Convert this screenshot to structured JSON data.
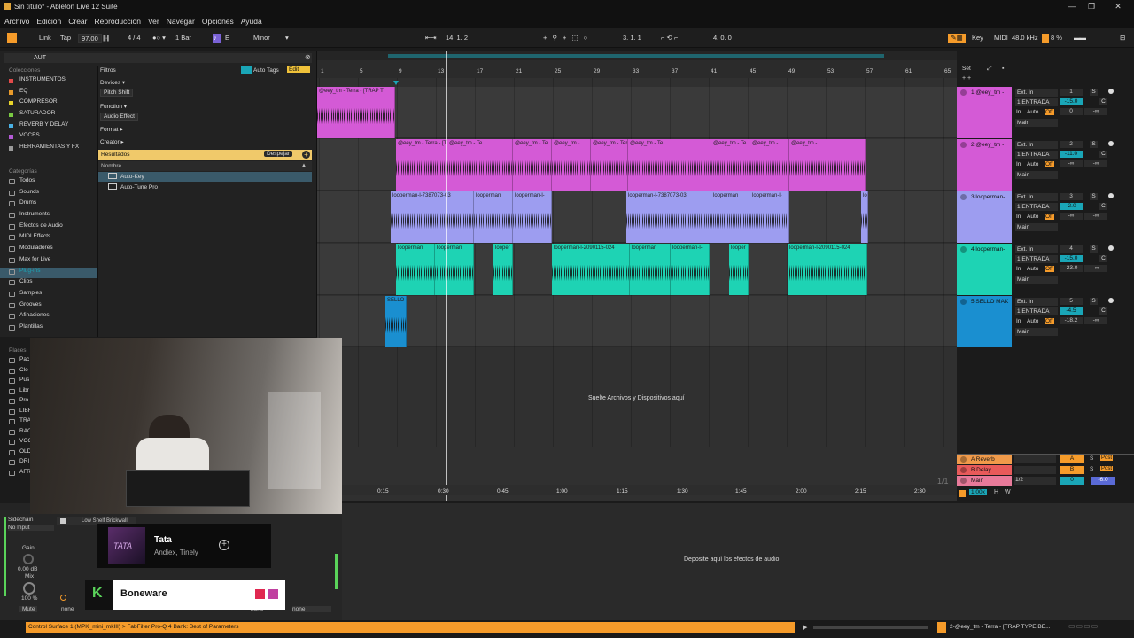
{
  "window": {
    "title": "Sin título* - Ableton Live 12 Suite",
    "controls": [
      "—",
      "❐",
      "✕"
    ]
  },
  "menu": [
    "Archivo",
    "Edición",
    "Crear",
    "Reproducción",
    "Ver",
    "Navegar",
    "Opciones",
    "Ayuda"
  ],
  "transport": {
    "link": "Link",
    "tap": "Tap",
    "tempo": "97.00",
    "signature": "4 / 4",
    "quantize": "1 Bar",
    "key": "E",
    "scale": "Minor",
    "position": "14.  1.  2",
    "loop_start": "3.  1.  1",
    "loop_length": "4.  0.  0",
    "key_label": "Key",
    "midi_label": "MIDI",
    "sample_rate": "48.0 kHz",
    "cpu": "8 %"
  },
  "browser": {
    "search": "AUT",
    "collections_header": "Colecciones",
    "collections": [
      {
        "label": "INSTRUMENTOS",
        "color": "#e34a4a"
      },
      {
        "label": "EQ",
        "color": "#e89a2a"
      },
      {
        "label": "COMPRESOR",
        "color": "#e8d42a"
      },
      {
        "label": "SATURADOR",
        "color": "#7ac943"
      },
      {
        "label": "REVERB Y DELAY",
        "color": "#4ab0e3"
      },
      {
        "label": "VOCES",
        "color": "#b45ad6"
      },
      {
        "label": "HERRAMIENTAS Y FX",
        "color": "#9a9a9a"
      }
    ],
    "categories_header": "Categorías",
    "categories": [
      "Todos",
      "Sounds",
      "Drums",
      "Instruments",
      "Efectos de Audio",
      "MIDI Effects",
      "Moduladores",
      "Max for Live",
      "Plug-ins",
      "Clips",
      "Samples",
      "Grooves",
      "Afinaciones",
      "Plantillas"
    ],
    "places_header": "Places",
    "places": [
      "Pac",
      "Clo",
      "Pus",
      "Libr",
      "Pro",
      "LIBR",
      "TRA",
      "RAC",
      "VOC",
      "OLD",
      "DRI",
      "AFR"
    ],
    "filters_label": "Filtros",
    "auto_tags": "Auto Tags",
    "edit": "Edit",
    "devices_label": "Devices ▾",
    "devices_tag": "Pitch Shift",
    "function_label": "Function ▾",
    "function_tag": "Audio Effect",
    "format_label": "Format ▸",
    "creator_label": "Creator ▸",
    "results_label": "Resultados",
    "clear_label": "Despejar",
    "name_col": "Nombre",
    "results": [
      "Auto-Key",
      "Auto-Tune Pro"
    ]
  },
  "ruler": {
    "bars": [
      "1",
      "5",
      "9",
      "13",
      "17",
      "21",
      "25",
      "29",
      "33",
      "37",
      "41",
      "45",
      "49",
      "53",
      "57",
      "61",
      "65"
    ],
    "set": "Set"
  },
  "timeline": {
    "times": [
      "0:15",
      "0:30",
      "0:45",
      "1:00",
      "1:15",
      "1:30",
      "1:45",
      "2:00",
      "2:15",
      "2:30"
    ],
    "page": "1/1"
  },
  "drop_hint": "Suelte Archivos y Dispositivos aquí",
  "device_hint": "Deposite aquí los efectos de audio",
  "tracks": [
    {
      "name": "1 @eey_tm -",
      "color": "#d45ad6",
      "input": "Ext. In",
      "channel": "1 ENTRADA",
      "volume": "-15.0",
      "pan": "C",
      "send": "0",
      "send2": "-∞",
      "number": "1",
      "out": "Main"
    },
    {
      "name": "2 @eey_tm -",
      "color": "#d45ad6",
      "input": "Ext. In",
      "channel": "1 ENTRADA",
      "volume": "-11.0",
      "pan": "C",
      "send": "-∞",
      "send2": "-∞",
      "number": "2",
      "out": "Main"
    },
    {
      "name": "3 looperman-",
      "color": "#9d9df0",
      "input": "Ext. In",
      "channel": "1 ENTRADA",
      "volume": "-2.0",
      "pan": "C",
      "send": "-∞",
      "send2": "-∞",
      "number": "3",
      "out": "Main"
    },
    {
      "name": "4 looperman-",
      "color": "#1ed3b4",
      "input": "Ext. In",
      "channel": "1 ENTRADA",
      "volume": "-15.0",
      "pan": "C",
      "send": "-23.0",
      "send2": "-∞",
      "number": "4",
      "out": "Main"
    },
    {
      "name": "5 SELLO MAK",
      "color": "#1a8fd0",
      "input": "Ext. In",
      "channel": "1 ENTRADA",
      "volume": "-4.5",
      "pan": "C",
      "send": "-18.2",
      "send2": "-∞",
      "number": "5",
      "out": "Main"
    }
  ],
  "io_labels": {
    "in": "In",
    "auto": "Auto",
    "off": "Off",
    "s": "S"
  },
  "returns": [
    {
      "name": "A Reverb",
      "color": "#f09a4a",
      "letter": "A",
      "post": "Post"
    },
    {
      "name": "B Delay",
      "color": "#e85a5a",
      "letter": "B",
      "post": "Post"
    },
    {
      "name": "Main",
      "color": "#e87a9a",
      "letter": "",
      "post": "",
      "fraction": "1/2",
      "volume": "0",
      "pan": "-6.0"
    }
  ],
  "clips": {
    "t1": [
      {
        "label": "@eey_tm - Terra - [TRAP T"
      }
    ],
    "t2": [
      "@eey_tm - Terra - [TRAP T",
      "@eey_tm - Te",
      "@eey_tm - Te",
      "@eey_tm -",
      "@eey_tm - Terra - [TRAP T",
      "@eey_tm - Te",
      "@eey_tm - Te",
      "@eey_tm -"
    ],
    "t3": [
      "looperman-l-7387073-03",
      "looperman",
      "looperman-l-",
      "looperman-l-7387073-03",
      "looperman",
      "looperman-l-"
    ],
    "t4": [
      "looperman",
      "looperman",
      "looper",
      "looperman-l-2090115-024",
      "looperman",
      "looperman-l-",
      "looper",
      "looperman-l-2090115-024"
    ],
    "t5": [
      "SELLO"
    ]
  },
  "device_panel": {
    "sidechain": "Sidechain",
    "no_input": "No Input",
    "gain": "Gain",
    "gain_val": "0.00 dB",
    "mix": "Mix",
    "mix_val": "100 %",
    "mute": "Mute",
    "preset": "Low Shelf Brickwall",
    "none1": "none",
    "none2": "none",
    "none3": "none"
  },
  "now_playing": {
    "song": "Tata",
    "artists": "Andiex, Tinely",
    "cover_text": "TATA"
  },
  "overlay_brand": {
    "name": "Boneware"
  },
  "status": {
    "left": "Control Surface 1 (MPK_mini_mkIII) > FabFilter Pro-Q 4 Bank: Best of Parameters",
    "right": "2-@eey_tm - Terra - [TRAP TYPE BE..."
  }
}
